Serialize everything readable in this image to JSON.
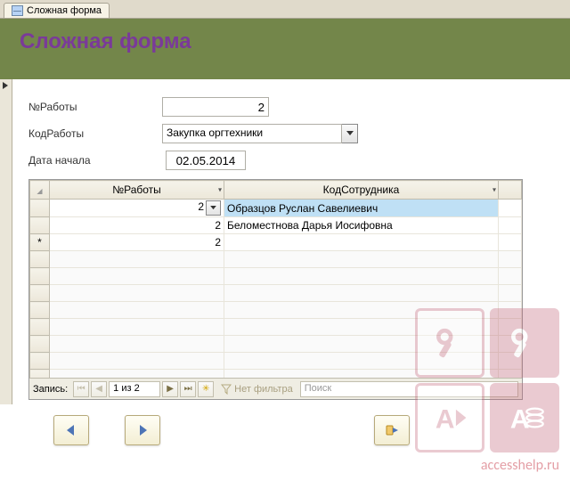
{
  "tab": {
    "title": "Сложная форма"
  },
  "header": {
    "title": "Сложная форма"
  },
  "fields": {
    "work_no": {
      "label": "№Работы",
      "value": "2"
    },
    "work_code": {
      "label": "КодРаботы",
      "value": "Закупка оргтехники"
    },
    "start_date": {
      "label": "Дата начала",
      "value": "02.05.2014"
    }
  },
  "subform": {
    "columns": {
      "work_no": "№Работы",
      "employee": "КодСотрудника"
    },
    "rows": [
      {
        "work_no": "2",
        "employee": "Образцов Руслан Савелиевич",
        "selected": true
      },
      {
        "work_no": "2",
        "employee": "Беломестнова Дарья Иосифовна",
        "selected": false
      }
    ],
    "new_row": {
      "work_no": "2",
      "employee": ""
    },
    "nav": {
      "label": "Запись:",
      "position": "1 из 2",
      "filter": "Нет фильтра",
      "search_placeholder": "Поиск"
    }
  },
  "watermark": "accesshelp.ru"
}
